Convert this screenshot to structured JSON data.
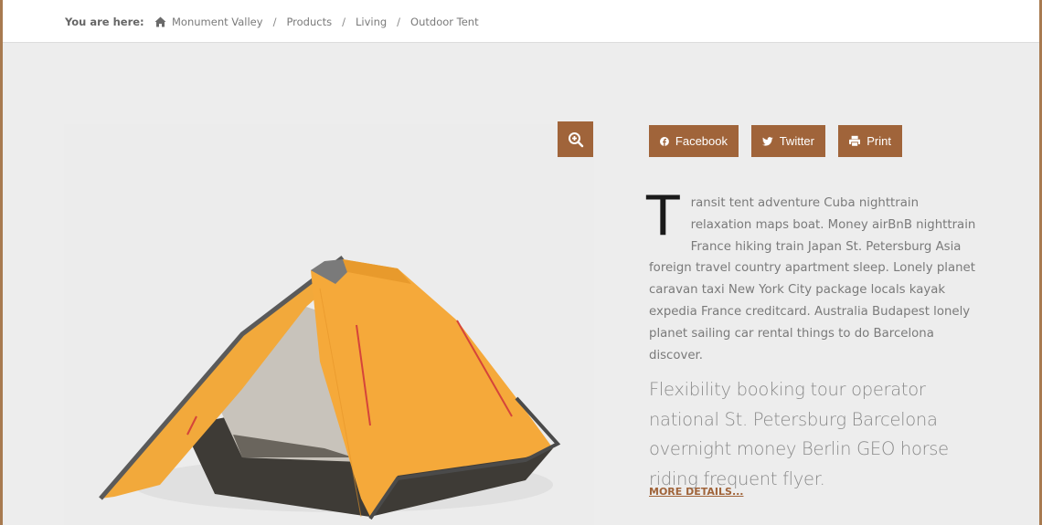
{
  "colors": {
    "accent": "#a0643a",
    "frame": "#a87a50",
    "background": "#ededed",
    "topbar": "#ffffff"
  },
  "breadcrumb": {
    "label": "You are here:",
    "home_icon": "home-icon",
    "items": [
      "Monument Valley",
      "Products",
      "Living",
      "Outdoor Tent"
    ],
    "separator": "/"
  },
  "product": {
    "image_alt": "Orange dome tent",
    "zoom_icon": "zoom-in-icon"
  },
  "share": {
    "facebook": {
      "label": "Facebook",
      "icon": "facebook-icon"
    },
    "twitter": {
      "label": "Twitter",
      "icon": "twitter-icon"
    },
    "print": {
      "label": "Print",
      "icon": "print-icon"
    }
  },
  "description": {
    "dropcap": "T",
    "body": "ransit tent adventure Cuba nighttrain relaxation maps boat. Money airBnB nighttrain France hiking train Japan St. Petersburg Asia foreign travel country apartment sleep. Lonely planet caravan taxi New York City package locals kayak expedia France creditcard. Australia Budapest lonely planet sailing car rental things to do Barcelona discover."
  },
  "lead": "Flexibility booking tour operator national St. Petersburg Barcelona overnight money Berlin GEO horse riding frequent flyer.",
  "more_link": "MORE DETAILS..."
}
